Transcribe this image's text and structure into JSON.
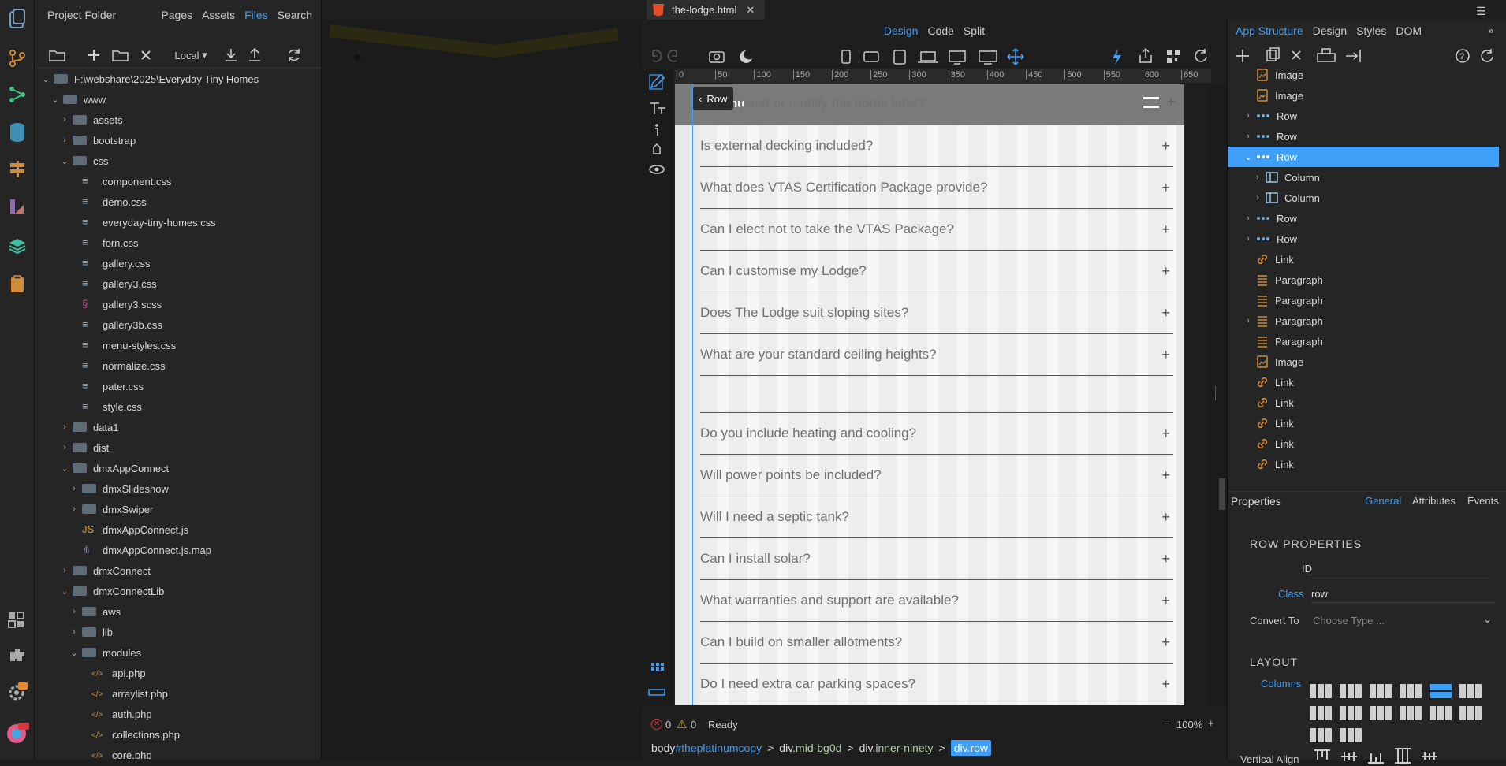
{
  "editor": {
    "file_tab": "the-lodge.html",
    "view_modes": [
      "Design",
      "Code",
      "Split"
    ],
    "active_view": "Design"
  },
  "left_panel": {
    "title": "Project Folder",
    "tabs": [
      "Pages",
      "Assets",
      "Files",
      "Search"
    ],
    "active_tab": "Files",
    "location": "Local",
    "tree": [
      {
        "label": "F:\\webshare\\2025\\Everyday Tiny Homes",
        "type": "folder",
        "depth": 0,
        "open": true
      },
      {
        "label": "www",
        "type": "folder",
        "depth": 1,
        "open": true
      },
      {
        "label": "assets",
        "type": "folder",
        "depth": 2,
        "open": false
      },
      {
        "label": "bootstrap",
        "type": "folder",
        "depth": 2,
        "open": false
      },
      {
        "label": "css",
        "type": "folder",
        "depth": 2,
        "open": true
      },
      {
        "label": "component.css",
        "type": "css",
        "depth": 3
      },
      {
        "label": "demo.css",
        "type": "css",
        "depth": 3
      },
      {
        "label": "everyday-tiny-homes.css",
        "type": "css",
        "depth": 3
      },
      {
        "label": "forn.css",
        "type": "css",
        "depth": 3
      },
      {
        "label": "gallery.css",
        "type": "css",
        "depth": 3
      },
      {
        "label": "gallery3.css",
        "type": "css",
        "depth": 3
      },
      {
        "label": "gallery3.scss",
        "type": "scss",
        "depth": 3
      },
      {
        "label": "gallery3b.css",
        "type": "css",
        "depth": 3
      },
      {
        "label": "menu-styles.css",
        "type": "css",
        "depth": 3
      },
      {
        "label": "normalize.css",
        "type": "css",
        "depth": 3
      },
      {
        "label": "pater.css",
        "type": "css",
        "depth": 3
      },
      {
        "label": "style.css",
        "type": "css",
        "depth": 3
      },
      {
        "label": "data1",
        "type": "folder",
        "depth": 2,
        "open": false
      },
      {
        "label": "dist",
        "type": "folder",
        "depth": 2,
        "open": false
      },
      {
        "label": "dmxAppConnect",
        "type": "folder",
        "depth": 2,
        "open": true
      },
      {
        "label": "dmxSlideshow",
        "type": "folder",
        "depth": 3,
        "open": false
      },
      {
        "label": "dmxSwiper",
        "type": "folder",
        "depth": 3,
        "open": false
      },
      {
        "label": "dmxAppConnect.js",
        "type": "js",
        "depth": 3
      },
      {
        "label": "dmxAppConnect.js.map",
        "type": "map",
        "depth": 3
      },
      {
        "label": "dmxConnect",
        "type": "folder",
        "depth": 2,
        "open": false
      },
      {
        "label": "dmxConnectLib",
        "type": "folder",
        "depth": 2,
        "open": true
      },
      {
        "label": "aws",
        "type": "folder",
        "depth": 3,
        "open": false
      },
      {
        "label": "lib",
        "type": "folder",
        "depth": 3,
        "open": false
      },
      {
        "label": "modules",
        "type": "folder",
        "depth": 3,
        "open": true
      },
      {
        "label": "api.php",
        "type": "php",
        "depth": 4
      },
      {
        "label": "arraylist.php",
        "type": "php",
        "depth": 4
      },
      {
        "label": "auth.php",
        "type": "php",
        "depth": 4
      },
      {
        "label": "collections.php",
        "type": "php",
        "depth": 4
      },
      {
        "label": "core.php",
        "type": "php",
        "depth": 4
      }
    ]
  },
  "design": {
    "row_badge": "Row",
    "menu_text": "nu",
    "top_question": "pand or modify the home later?",
    "questions": [
      "Is external decking included?",
      "What does VTAS Certification Package provide?",
      "Can I elect not to take the VTAS Package?",
      "Can I customise my Lodge?",
      "Does The Lodge suit sloping sites?",
      "What are your standard ceiling heights?",
      "",
      "Do you include heating and cooling?",
      "Will power points be included?",
      "Will I need a septic tank?",
      "Can I install solar?",
      "What warranties and support are available?",
      "Can I build on smaller allotments?",
      "Do I need extra car parking spaces?"
    ],
    "ruler_ticks": [
      "0",
      "50",
      "100",
      "150",
      "200",
      "250",
      "300",
      "350",
      "400",
      "450",
      "500",
      "550",
      "600",
      "650"
    ]
  },
  "status": {
    "errors": "0",
    "warnings": "0",
    "state": "Ready",
    "zoom": "100%"
  },
  "breadcrumb": [
    {
      "tag": "body",
      "qual": "#theplatinumcopy"
    },
    {
      "tag": "div",
      "qual": ".mid-bg0d"
    },
    {
      "tag": "div",
      "qual": ".inner-ninety"
    },
    {
      "tag": "div.row",
      "qual": ""
    }
  ],
  "right_panel": {
    "tabs": [
      "App Structure",
      "Design",
      "Styles",
      "DOM"
    ],
    "active_tab": "App Structure",
    "structure": [
      {
        "label": "Image",
        "icon": "image-icon",
        "depth": 1
      },
      {
        "label": "Image",
        "icon": "image-icon",
        "depth": 1
      },
      {
        "label": "Row",
        "icon": "row-icon",
        "depth": 1,
        "chevron": true
      },
      {
        "label": "Row",
        "icon": "row-icon",
        "depth": 1,
        "chevron": true
      },
      {
        "label": "Row",
        "icon": "row-icon",
        "depth": 1,
        "chevron": true,
        "open": true,
        "selected": true
      },
      {
        "label": "Column",
        "icon": "column-icon",
        "depth": 2,
        "chevron": true
      },
      {
        "label": "Column",
        "icon": "column-icon",
        "depth": 2,
        "chevron": true
      },
      {
        "label": "Row",
        "icon": "row-icon",
        "depth": 1,
        "chevron": true
      },
      {
        "label": "Row",
        "icon": "row-icon",
        "depth": 1,
        "chevron": true
      },
      {
        "label": "Link",
        "icon": "link-icon",
        "depth": 1
      },
      {
        "label": "Paragraph",
        "icon": "paragraph-icon",
        "depth": 1
      },
      {
        "label": "Paragraph",
        "icon": "paragraph-icon",
        "depth": 1
      },
      {
        "label": "Paragraph",
        "icon": "paragraph-icon",
        "depth": 1,
        "chevron": true
      },
      {
        "label": "Paragraph",
        "icon": "paragraph-icon",
        "depth": 1
      },
      {
        "label": "Image",
        "icon": "image-icon",
        "depth": 1
      },
      {
        "label": "Link",
        "icon": "link-icon",
        "depth": 1
      },
      {
        "label": "Link",
        "icon": "link-icon",
        "depth": 1
      },
      {
        "label": "Link",
        "icon": "link-icon",
        "depth": 1
      },
      {
        "label": "Link",
        "icon": "link-icon",
        "depth": 1
      },
      {
        "label": "Link",
        "icon": "link-icon",
        "depth": 1
      }
    ],
    "properties": {
      "title": "Properties",
      "tabs": [
        "General",
        "Attributes",
        "Events"
      ],
      "active_tab": "General",
      "section": "ROW PROPERTIES",
      "id_label": "ID",
      "id_value": "",
      "class_label": "Class",
      "class_value": "row",
      "convert_label": "Convert To",
      "convert_placeholder": "Choose Type ...",
      "layout_section": "LAYOUT",
      "columns_label": "Columns",
      "valign_label": "Vertical Align"
    }
  },
  "colors": {
    "accent": "#3f9ef5",
    "panel_bg": "#252526",
    "selected_row": "#3f9ef5"
  }
}
